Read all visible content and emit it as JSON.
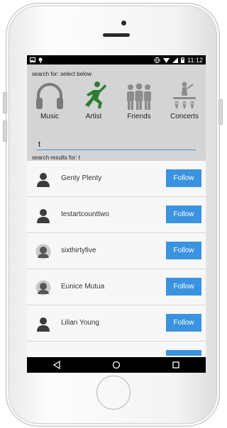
{
  "status_bar": {
    "time": "11:12",
    "icons": [
      "image-icon",
      "notification-icon",
      "vibrate-icon",
      "wifi-icon",
      "signal-icon",
      "battery-icon"
    ]
  },
  "search": {
    "hint": "search for: select below",
    "query": "t",
    "results_label": "search results for: t"
  },
  "categories": [
    {
      "label": "Music",
      "icon": "headphones-icon",
      "selected": false
    },
    {
      "label": "Artist",
      "icon": "artist-icon",
      "selected": true
    },
    {
      "label": "Friends",
      "icon": "friends-icon",
      "selected": false
    },
    {
      "label": "Concerts",
      "icon": "concert-icon",
      "selected": false
    }
  ],
  "results": [
    {
      "name": "Genty Plenty",
      "action": "Follow",
      "avatar": "person-icon"
    },
    {
      "name": "testartcounttwo",
      "action": "Follow",
      "avatar": "person-icon"
    },
    {
      "name": "sixthirtyfive",
      "action": "Follow",
      "avatar": "profile-photo"
    },
    {
      "name": "Eunice Mutua",
      "action": "Follow",
      "avatar": "profile-photo"
    },
    {
      "name": "Lilian Young",
      "action": "Follow",
      "avatar": "person-icon"
    }
  ],
  "colors": {
    "accent": "#3a92e0",
    "selected_category": "#2e7d32",
    "panel": "#d4d4d4"
  }
}
